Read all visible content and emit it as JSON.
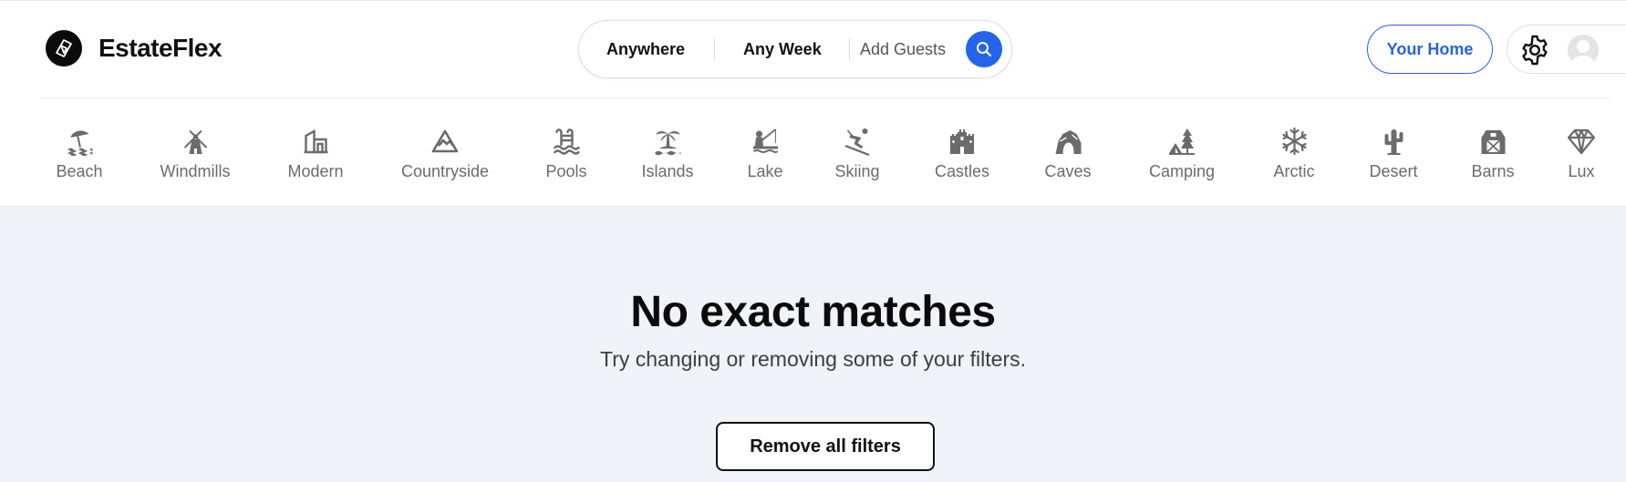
{
  "brand": {
    "name": "EstateFlex",
    "logo_icon": "estateflex-logo-icon"
  },
  "search": {
    "location": "Anywhere",
    "dates": "Any Week",
    "guests": "Add Guests",
    "button_icon": "search-icon",
    "button_color": "#2563eb"
  },
  "header": {
    "your_home_label": "Your Home",
    "settings_icon": "gear-icon",
    "avatar_icon": "user-avatar-icon"
  },
  "categories": [
    {
      "label": "Beach",
      "icon": "beach-umbrella-icon"
    },
    {
      "label": "Windmills",
      "icon": "windmill-icon"
    },
    {
      "label": "Modern",
      "icon": "modern-building-icon"
    },
    {
      "label": "Countryside",
      "icon": "mountain-icon"
    },
    {
      "label": "Pools",
      "icon": "pool-ladder-icon"
    },
    {
      "label": "Islands",
      "icon": "palm-island-icon"
    },
    {
      "label": "Lake",
      "icon": "fishing-icon"
    },
    {
      "label": "Skiing",
      "icon": "skier-icon"
    },
    {
      "label": "Castles",
      "icon": "castle-icon"
    },
    {
      "label": "Caves",
      "icon": "cave-icon"
    },
    {
      "label": "Camping",
      "icon": "camping-tent-icon"
    },
    {
      "label": "Arctic",
      "icon": "snowflake-icon"
    },
    {
      "label": "Desert",
      "icon": "cactus-icon"
    },
    {
      "label": "Barns",
      "icon": "barn-icon"
    },
    {
      "label": "Lux",
      "icon": "diamond-icon"
    }
  ],
  "empty_state": {
    "title": "No exact matches",
    "subtitle": "Try changing or removing some of your filters.",
    "button_label": "Remove all filters"
  },
  "colors": {
    "accent": "#2563eb",
    "page_bg": "#f0f3f7",
    "icon_gray": "#6b6b6b"
  }
}
